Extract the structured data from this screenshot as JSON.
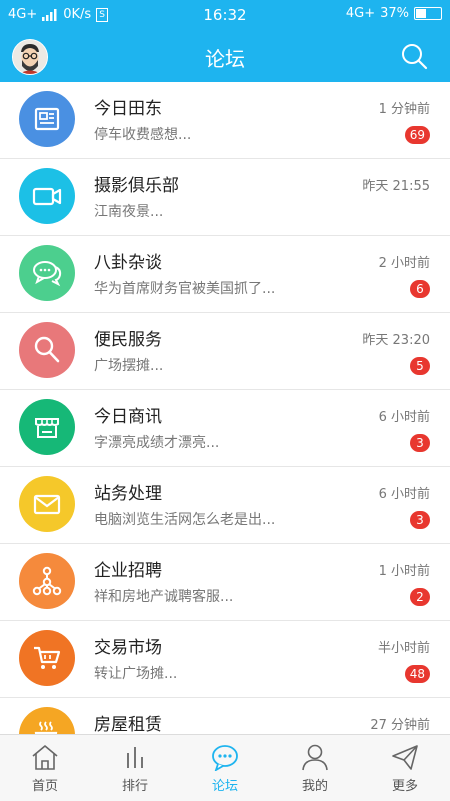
{
  "status_bar": {
    "network_left": "4G+",
    "speed": "0K/s",
    "sim": "S",
    "time": "16:32",
    "network_right": "4G+",
    "battery_percent": "37%",
    "battery_level": 0.37
  },
  "header": {
    "title": "论坛",
    "avatar_icon": "avatar-cartoon-icon",
    "search_icon": "search-icon"
  },
  "forums": [
    {
      "name": "今日田东",
      "time": "1 分钟前",
      "preview": "停车收费感想...",
      "badge": "69",
      "color": "#4a90e2",
      "icon": "newspaper-icon"
    },
    {
      "name": "摄影俱乐部",
      "time": "昨天 21:55",
      "preview": "江南夜景...",
      "badge": "",
      "color": "#1cc0e6",
      "icon": "video-camera-icon"
    },
    {
      "name": "八卦杂谈",
      "time": "2 小时前",
      "preview": "华为首席财务官被美国抓了...",
      "badge": "6",
      "color": "#4ccf8e",
      "icon": "chat-bubbles-icon"
    },
    {
      "name": "便民服务",
      "time": "昨天 23:20",
      "preview": "广场摆摊...",
      "badge": "5",
      "color": "#e8787a",
      "icon": "magnifier-icon"
    },
    {
      "name": "今日商讯",
      "time": "6 小时前",
      "preview": "字漂亮成绩才漂亮...",
      "badge": "3",
      "color": "#16b877",
      "icon": "storefront-icon"
    },
    {
      "name": "站务处理",
      "time": "6 小时前",
      "preview": "电脑浏览生活网怎么老是出...",
      "badge": "3",
      "color": "#f5c82a",
      "icon": "envelope-icon"
    },
    {
      "name": "企业招聘",
      "time": "1 小时前",
      "preview": "祥和房地产诚聘客服...",
      "badge": "2",
      "color": "#f58a3c",
      "icon": "org-chart-icon"
    },
    {
      "name": "交易市场",
      "time": "半小时前",
      "preview": "转让广场摊...",
      "badge": "48",
      "color": "#f07424",
      "icon": "shopping-cart-icon"
    },
    {
      "name": "房屋租赁",
      "time": "27 分钟前",
      "preview": "",
      "badge": "",
      "color": "#f5a623",
      "icon": "coffee-cup-icon"
    }
  ],
  "tabs": [
    {
      "label": "首页",
      "icon": "home-icon",
      "active": false
    },
    {
      "label": "排行",
      "icon": "ranking-bars-icon",
      "active": false
    },
    {
      "label": "论坛",
      "icon": "forum-bubble-icon",
      "active": true
    },
    {
      "label": "我的",
      "icon": "person-icon",
      "active": false
    },
    {
      "label": "更多",
      "icon": "paper-plane-icon",
      "active": false
    }
  ]
}
